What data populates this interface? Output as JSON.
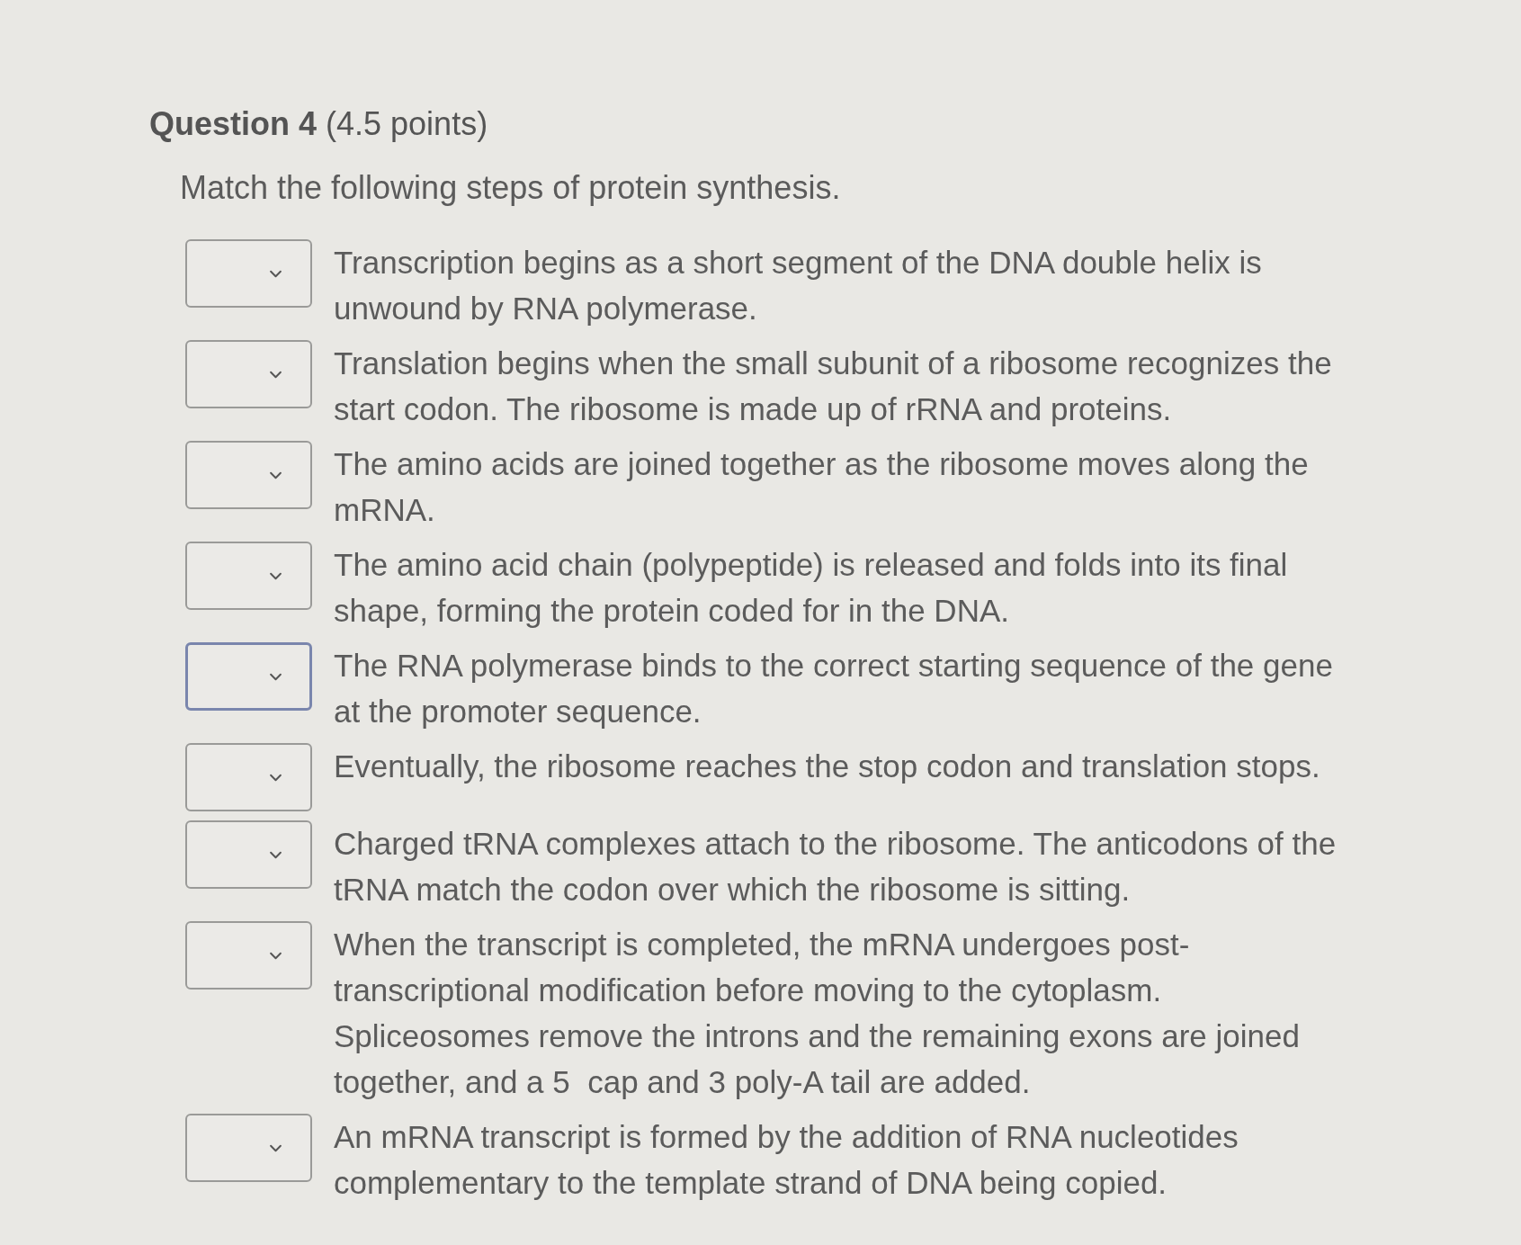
{
  "question": {
    "title": "**Question 4** (4.5 points)",
    "prompt": "Match the following steps of protein synthesis."
  },
  "items": [
    {
      "focused": false,
      "text": "Transcription begins as a short segment of the DNA double helix is unwound by RNA polymerase."
    },
    {
      "focused": false,
      "text": "Translation begins when the small subunit of a ribosome recognizes the start codon. The ribosome is made up of rRNA and proteins."
    },
    {
      "focused": false,
      "text": "The amino acids are joined together as the ribosome moves along the mRNA."
    },
    {
      "focused": false,
      "text": "The amino acid chain (polypeptide) is released and folds into its final shape, forming the protein coded for in the DNA."
    },
    {
      "focused": true,
      "text": "The RNA polymerase binds to the correct starting sequence of the gene at the promoter sequence."
    },
    {
      "focused": false,
      "text": "Eventually, the ribosome reaches the stop codon and translation stops."
    },
    {
      "focused": false,
      "text": "Charged tRNA complexes attach to the ribosome. The anticodons of the tRNA match the codon over which the ribosome is sitting."
    },
    {
      "focused": false,
      "text": "When the transcript is completed, the mRNA undergoes post-transcriptional modification before moving to the cytoplasm. Spliceosomes remove the introns and the remaining exons are joined together, and a 5  cap and 3 poly-A tail are added."
    },
    {
      "focused": false,
      "text": "An mRNA transcript is formed by the addition of RNA nucleotides complementary to the template strand of DNA being copied."
    }
  ]
}
